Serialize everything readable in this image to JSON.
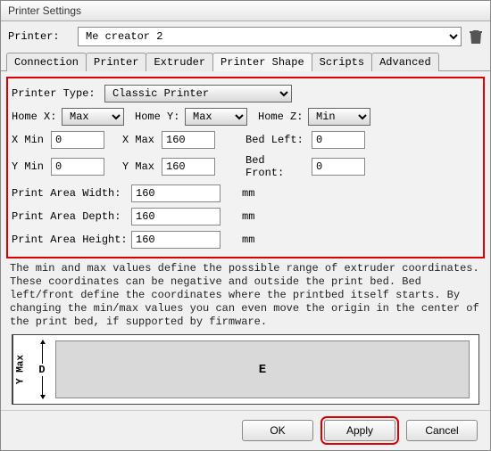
{
  "window": {
    "title": "Printer Settings"
  },
  "printerRow": {
    "label": "Printer:",
    "selected": "Me creator 2"
  },
  "tabs": {
    "items": [
      {
        "label": "Connection"
      },
      {
        "label": "Printer"
      },
      {
        "label": "Extruder"
      },
      {
        "label": "Printer Shape"
      },
      {
        "label": "Scripts"
      },
      {
        "label": "Advanced"
      }
    ],
    "activeIndex": 3
  },
  "form": {
    "printerTypeLabel": "Printer Type:",
    "printerType": "Classic Printer",
    "homeXLabel": "Home X:",
    "homeX": "Max",
    "homeYLabel": "Home Y:",
    "homeY": "Max",
    "homeZLabel": "Home Z:",
    "homeZ": "Min",
    "xMinLabel": "X Min",
    "xMin": "0",
    "xMaxLabel": "X Max",
    "xMax": "160",
    "bedLeftLabel": "Bed Left:",
    "bedLeft": "0",
    "yMinLabel": "Y Min",
    "yMin": "0",
    "yMaxLabel": "Y Max",
    "yMax": "160",
    "bedFrontLabel": "Bed Front:",
    "bedFront": "0",
    "areaWidthLabel": "Print Area Width:",
    "areaWidth": "160",
    "areaDepthLabel": "Print Area Depth:",
    "areaDepth": "160",
    "areaHeightLabel": "Print Area Height:",
    "areaHeight": "160",
    "unit": "mm"
  },
  "helpText": "The min and max values define the possible range of extruder coordinates. These coordinates can be negative and outside the print bed. Bed left/front define the coordinates where the printbed itself starts. By changing the min/max values you can even move the origin in the center of the print bed, if supported by firmware.",
  "diagram": {
    "yMax": "Y Max",
    "d": "D",
    "e": "E"
  },
  "buttons": {
    "ok": "OK",
    "apply": "Apply",
    "cancel": "Cancel"
  }
}
